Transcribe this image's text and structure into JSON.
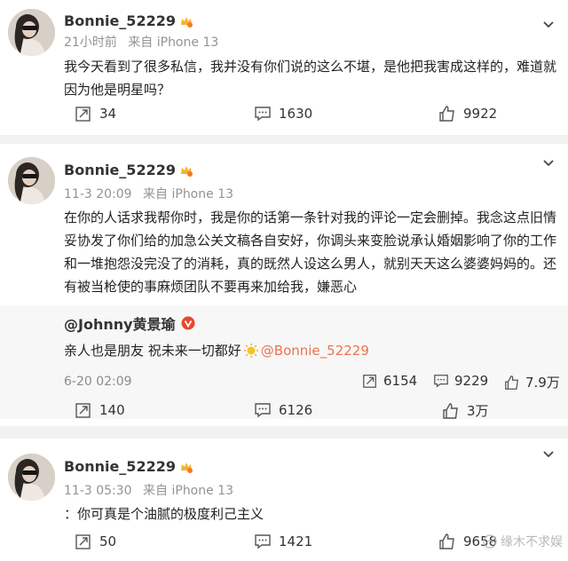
{
  "posts": [
    {
      "username": "Bonnie_52229",
      "time": "21小时前",
      "source": "来自 iPhone 13",
      "content": "我今天看到了很多私信，我并没有你们说的这么不堪，是他把我害成这样的，难道就因为他是明星吗？",
      "reposts": "34",
      "comments": "1630",
      "likes": "9922"
    },
    {
      "username": "Bonnie_52229",
      "time": "11-3 20:09",
      "source": "来自 iPhone 13",
      "content": "在你的人话求我帮你时，我是你的话第一条针对我的评论一定会删掉。我念这点旧情妥协发了你们给的加急公关文稿各自安好，你调头来变脸说承认婚姻影响了你的工作和一堆抱怨没完没了的消耗，真的既然人设这么男人，就别天天这么婆婆妈妈的。还有被当枪使的事麻烦团队不要再来加给我，嫌恶心",
      "quoted": {
        "author": "@Johnny黄景瑜",
        "text": "亲人也是朋友 祝未来一切都好",
        "mention": "@Bonnie_52229",
        "time": "6-20 02:09",
        "reposts": "6154",
        "comments": "9229",
        "likes": "7.9万"
      },
      "reposts": "140",
      "comments": "6126",
      "likes": "3万"
    },
    {
      "username": "Bonnie_52229",
      "time": "11-3 05:30",
      "source": "来自 iPhone 13",
      "content": "：你可真是个油腻的极度利己主义",
      "reposts": "50",
      "comments": "1421",
      "likes": "9658"
    }
  ],
  "watermark": "缘木不求娱",
  "colors": {
    "mention": "#eb7350",
    "meta": "#939393",
    "background": "#f2f2f2"
  }
}
